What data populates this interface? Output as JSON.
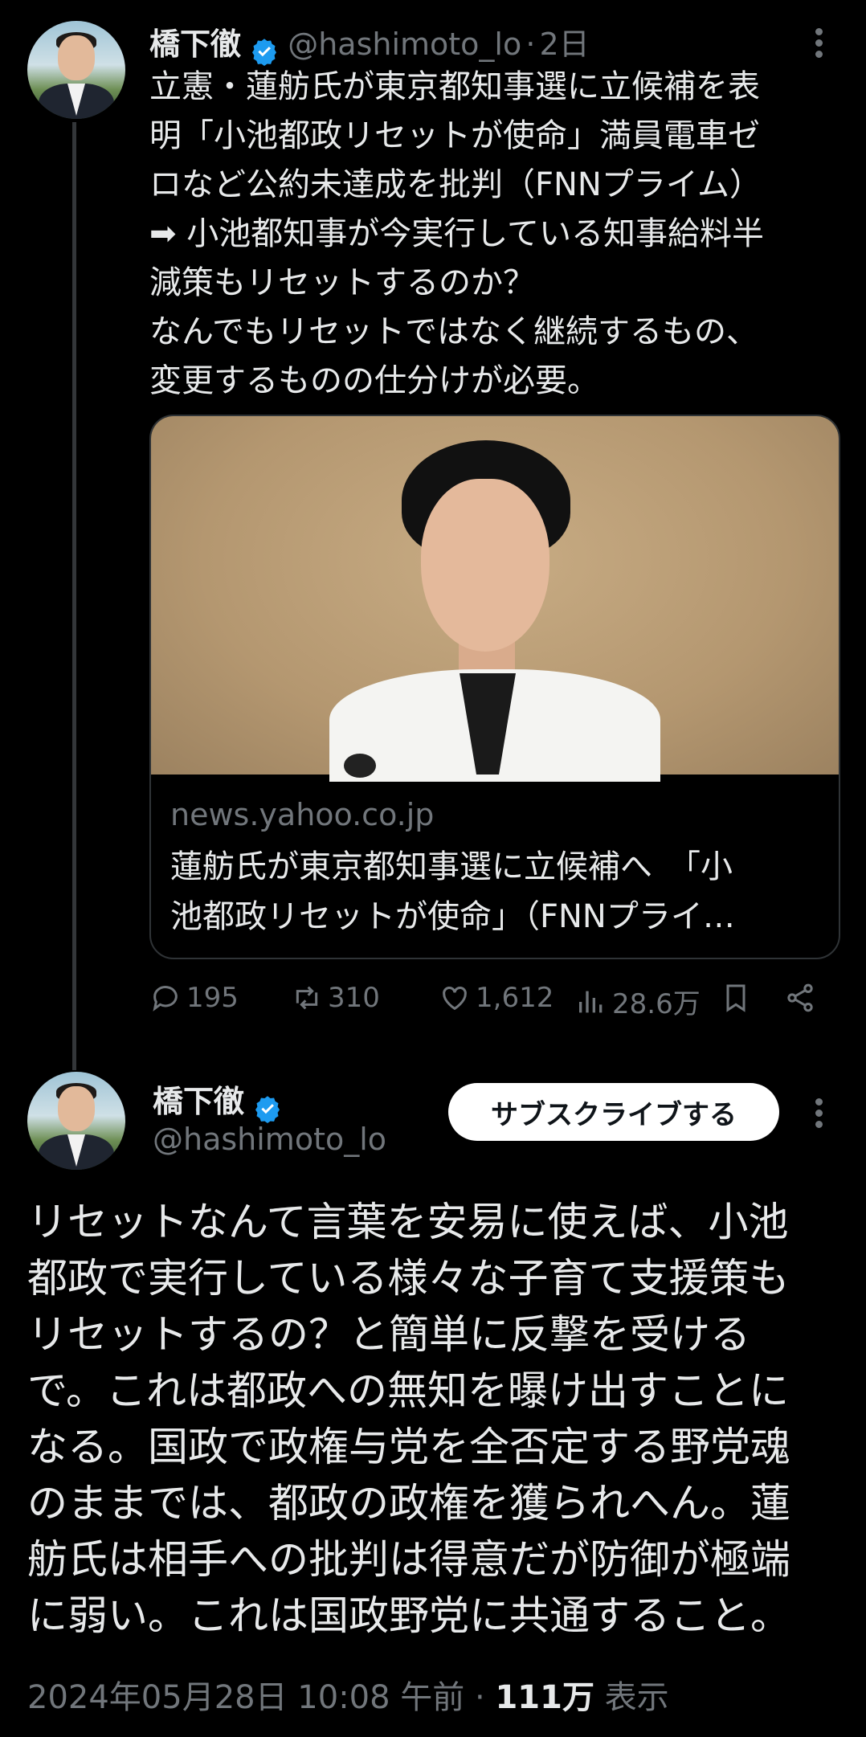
{
  "tweet1": {
    "display_name": "橋下徹",
    "handle": "@hashimoto_lo",
    "separator": "·",
    "time": "2日",
    "text": "立憲・蓮舫氏が東京都知事選に立候補を表\n明「小池都政リセットが使命」満員電車ゼ\nロなど公約未達成を批判（FNNプライム）\n➡ 小池都知事が今実行している知事給料半\n減策もリセットするのか？\nなんでもリセットではなく継続するもの、\n変更するものの仕分けが必要。",
    "card": {
      "domain": "news.yahoo.co.jp",
      "title": "蓮舫氏が東京都知事選に立候補へ　「小\n池都政リセットが使命」（FNNプライ…"
    },
    "stats": {
      "replies": "195",
      "reposts": "310",
      "likes": "1,612",
      "views": "28.6万"
    },
    "icons": [
      "reply-icon",
      "repost-icon",
      "like-icon",
      "views-icon",
      "bookmark-icon",
      "share-icon",
      "more-icon",
      "verified-icon"
    ]
  },
  "tweet2": {
    "display_name": "橋下徹",
    "handle": "@hashimoto_lo",
    "subscribe_label": "サブスクライブする",
    "text": "リセットなんて言葉を安易に使えば、小池\n都政で実行している様々な子育て支援策も\nリセットするの？と簡単に反撃を受ける\nで。これは都政への無知を曝け出すことに\nなる。国政で政権与党を全否定する野党魂\nのままでは、都政の政権を獲られへん。蓮\n舫氏は相手への批判は得意だが防御が極端\nに弱い。これは国政野党に共通すること。",
    "timestamp": "2024年05月28日 10:08 午前",
    "separator": "·",
    "views_count": "111万",
    "views_label": "表示"
  },
  "colors": {
    "background": "#000000",
    "text": "#e7e9ea",
    "muted": "#71767b",
    "verified": "#1d9bf0",
    "border": "#2f3336"
  }
}
